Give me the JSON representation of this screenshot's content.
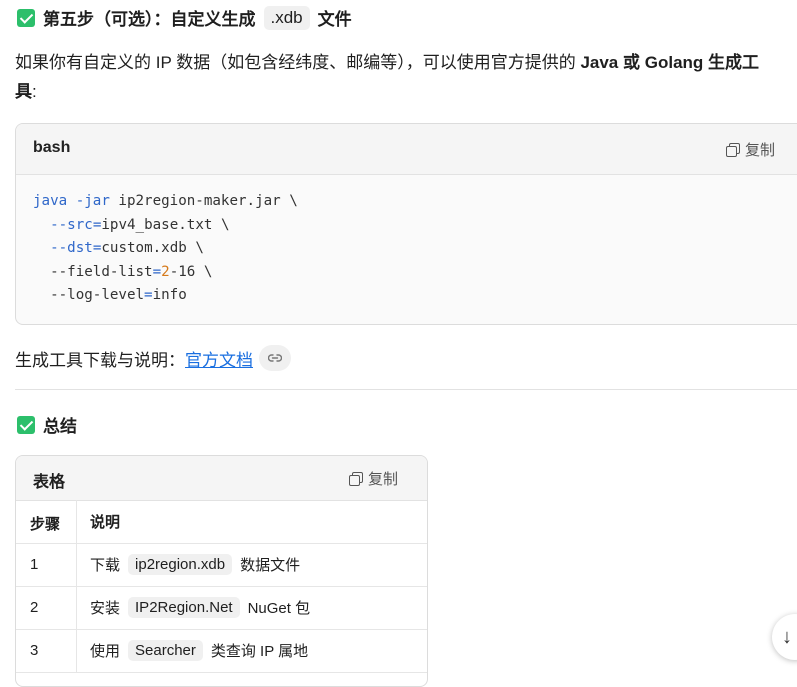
{
  "step5": {
    "heading_prefix": "第五步（可选）：自定义生成",
    "heading_code": ".xdb",
    "heading_suffix": "文件",
    "para_line1_a": "如果你有自定义的 IP 数据（如包含经纬度、邮编等），可以使用官方提供的 ",
    "para_java": "Java",
    "para_or": "或",
    "para_golang": "Golang",
    "para_tool_a": "生成工",
    "para_tool_b": "具",
    "para_colon": ":"
  },
  "code_block": {
    "language": "bash",
    "copy_label": "复制",
    "lines": [
      {
        "parts": [
          {
            "t": "java",
            "c": "kw"
          },
          {
            "t": " ",
            "c": ""
          },
          {
            "t": "-jar",
            "c": "kw"
          },
          {
            "t": " ip2region-maker.jar \\",
            "c": ""
          }
        ]
      },
      {
        "parts": [
          {
            "t": "  ",
            "c": ""
          },
          {
            "t": "--src",
            "c": "kw"
          },
          {
            "t": "=",
            "c": "op"
          },
          {
            "t": "ipv4_base.txt \\",
            "c": ""
          }
        ]
      },
      {
        "parts": [
          {
            "t": "  ",
            "c": ""
          },
          {
            "t": "--dst",
            "c": "kw"
          },
          {
            "t": "=",
            "c": "op"
          },
          {
            "t": "custom.xdb \\",
            "c": ""
          }
        ]
      },
      {
        "parts": [
          {
            "t": "  --field-list",
            "c": ""
          },
          {
            "t": "=",
            "c": "op"
          },
          {
            "t": "2",
            "c": "num"
          },
          {
            "t": "-16 \\",
            "c": ""
          }
        ]
      },
      {
        "parts": [
          {
            "t": "  --log-level",
            "c": ""
          },
          {
            "t": "=",
            "c": "op"
          },
          {
            "t": "info",
            "c": ""
          }
        ]
      }
    ]
  },
  "download": {
    "label": "生成工具下载与说明：",
    "link_text": "官方文档"
  },
  "summary": {
    "heading": "总结"
  },
  "table": {
    "title": "表格",
    "copy_label": "复制",
    "headers": [
      "步骤",
      "说明"
    ],
    "rows": [
      {
        "step": "1",
        "pre": "下载",
        "code": "ip2region.xdb",
        "post": "数据文件"
      },
      {
        "step": "2",
        "pre": "安装",
        "code": "IP2Region.Net",
        "post": "NuGet 包"
      },
      {
        "step": "3",
        "pre": "使用",
        "code": "Searcher",
        "post": "类查询 IP 属地"
      }
    ]
  },
  "scroll_button_icon": "arrow-down-icon",
  "colors": {
    "check_green": "#2cbf6b",
    "link_blue": "#1a6fe0",
    "code_keyword": "#2f67c9",
    "code_number": "#d57a1c"
  }
}
